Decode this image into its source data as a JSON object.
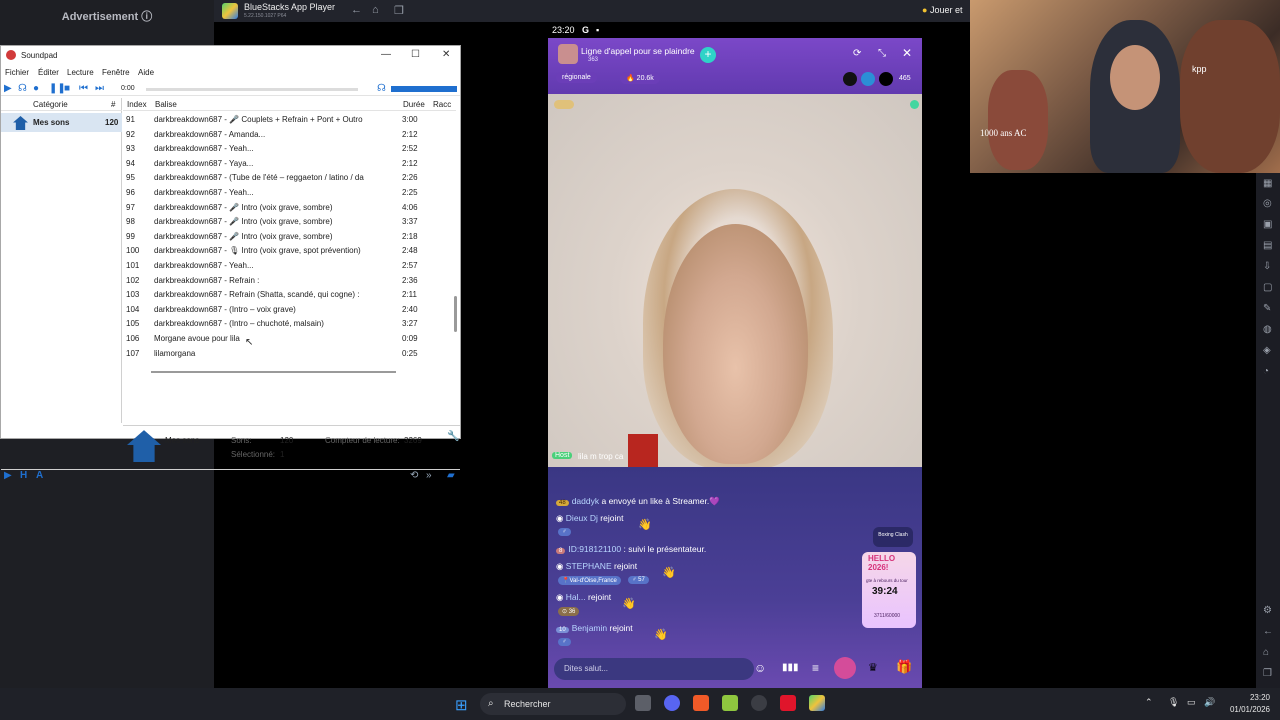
{
  "ad": {
    "label": "Advertisement ⓘ"
  },
  "bluestacks": {
    "title": "BlueStacks App Player",
    "version": "5.22.150.1027 P64",
    "jouer": "Jouer et"
  },
  "soundpad": {
    "title": "Soundpad",
    "menu": [
      "Fichier",
      "Éditer",
      "Lecture",
      "Fenêtre",
      "Aide"
    ],
    "time": "0:00",
    "category_header": "Catégorie",
    "count_header": "#",
    "category": {
      "label": "Mes sons",
      "count": "120"
    },
    "columns": {
      "index": "Index",
      "tag": "Balise",
      "duration": "Durée",
      "shortcut": "Racc"
    },
    "rows": [
      {
        "index": "91",
        "tag": "darkbreakdown687 - 🎤 Couplets + Refrain + Pont + Outro",
        "duration": "3:00"
      },
      {
        "index": "92",
        "tag": "darkbreakdown687 - Amanda...",
        "duration": "2:12"
      },
      {
        "index": "93",
        "tag": "darkbreakdown687 - Yeah...",
        "duration": "2:52"
      },
      {
        "index": "94",
        "tag": "darkbreakdown687 - Yaya...",
        "duration": "2:12"
      },
      {
        "index": "95",
        "tag": "darkbreakdown687 - (Tube de l'été – reggaeton / latino / da",
        "duration": "2:26"
      },
      {
        "index": "96",
        "tag": "darkbreakdown687 - Yeah...",
        "duration": "2:25"
      },
      {
        "index": "97",
        "tag": "darkbreakdown687 - 🎤 Intro (voix grave, sombre)",
        "duration": "4:06"
      },
      {
        "index": "98",
        "tag": "darkbreakdown687 - 🎤 Intro (voix grave, sombre)",
        "duration": "3:37"
      },
      {
        "index": "99",
        "tag": "darkbreakdown687 - 🎤 Intro (voix grave, sombre)",
        "duration": "2:18"
      },
      {
        "index": "100",
        "tag": "darkbreakdown687 - 🎙 Intro (voix grave, spot prévention)",
        "duration": "2:48"
      },
      {
        "index": "101",
        "tag": "darkbreakdown687 - Yeah...",
        "duration": "2:57"
      },
      {
        "index": "102",
        "tag": "darkbreakdown687 - Refrain :",
        "duration": "2:36"
      },
      {
        "index": "103",
        "tag": "darkbreakdown687 - Refrain (Shatta, scandé, qui cogne) :",
        "duration": "2:11"
      },
      {
        "index": "104",
        "tag": "darkbreakdown687 - (Intro – voix grave)",
        "duration": "2:40"
      },
      {
        "index": "105",
        "tag": "darkbreakdown687 - (Intro – chuchoté, malsain)",
        "duration": "3:27"
      },
      {
        "index": "106",
        "tag": "Morgane avoue pour lila",
        "duration": "0:09"
      },
      {
        "index": "107",
        "tag": "lilamorgana",
        "duration": "0:25"
      }
    ],
    "info": {
      "name": "Mes sons",
      "sons_label": "Sons:",
      "sons_value": "120",
      "selected_label": "Sélectionné:",
      "selected_value": "1",
      "counter_label": "Compteur de lecture:",
      "counter_value": "3269"
    }
  },
  "phone": {
    "time": "23:20",
    "title": "Ligne d'appel pour se plaindre",
    "viewers_small": "363",
    "regionale": "régionale",
    "likes": "20.6k",
    "online": "465",
    "host_tag": "Host",
    "host_text": "lila m trop ca",
    "chat": [
      {
        "level": "48",
        "user": "daddyk",
        "text": "a envoyé un like à Streamer.💜"
      },
      {
        "level": "",
        "user": "Dieux Dj",
        "text": "rejoint"
      },
      {
        "level": "8",
        "user": "ID:918121100",
        "text": ": suivi le présentateur."
      },
      {
        "level": "",
        "user": "STEPHANE",
        "text": "rejoint"
      },
      {
        "level": "",
        "user": "Hal...",
        "text": "rejoint"
      },
      {
        "level": "10",
        "user": "Benjamin",
        "text": "rejoint"
      }
    ],
    "stephane_loc": "Val-d'Oise,France",
    "stephane_num": "57",
    "hal_num": "36",
    "boxing": "Boxing Clash",
    "hello": "HELLO 2026!",
    "countdown_label": "gte à rebours du tour",
    "countdown": "39:24",
    "goal": "3711/60000",
    "input_placeholder": "Dites salut..."
  },
  "webcam": {
    "jersey_text": "1000 ans AC",
    "kpp": "kpp"
  },
  "taskbar": {
    "search": "Rechercher",
    "time": "23:20",
    "date": "01/01/2026"
  }
}
